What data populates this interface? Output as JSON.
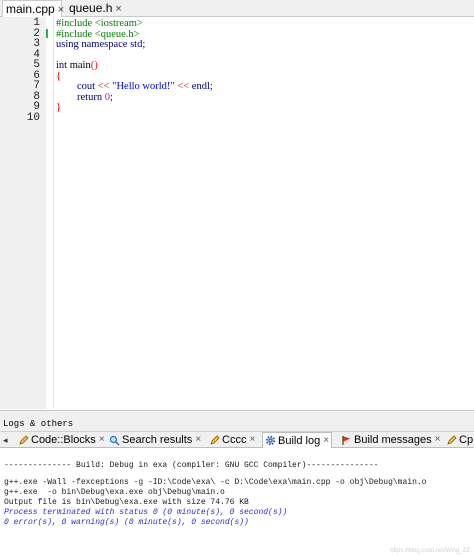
{
  "editor": {
    "tabs": [
      {
        "label": "main.cpp",
        "close": "×"
      },
      {
        "label": "queue.h",
        "close": "×"
      }
    ],
    "line_numbers": [
      "1",
      "2",
      "3",
      "4",
      "5",
      "6",
      "7",
      "8",
      "9",
      "10"
    ],
    "lines": {
      "l1": "#include <iostream>",
      "l2": "#include <queue.h>",
      "l3_kw": "using namespace",
      "l3_rest": " std;",
      "l5_kw": "int",
      "l5_name": " main",
      "l5_paren": "()",
      "l6": "{",
      "l7_a": "cout ",
      "l7_op1": "<<",
      "l7_str": " \"Hello world!\" ",
      "l7_op2": "<<",
      "l7_b": " endl;",
      "l8_kw": "return",
      "l8_num": " 0",
      "l8_end": ";",
      "l9": "}"
    }
  },
  "logs": {
    "title": "Logs & others",
    "scroll_arrow": "◂",
    "tabs": [
      {
        "label": "Code::Blocks",
        "close": "×"
      },
      {
        "label": "Search results",
        "close": "×"
      },
      {
        "label": "Cccc",
        "close": "×"
      },
      {
        "label": "Build log",
        "close": "×"
      },
      {
        "label": "Build messages",
        "close": "×"
      },
      {
        "label": "Cp"
      }
    ],
    "lines": [
      "-------------- Build: Debug in exa (compiler: GNU GCC Compiler)---------------",
      "g++.exe -Wall -fexceptions -g -ID:\\Code\\exa\\ -c D:\\Code\\exa\\main.cpp -o obj\\Debug\\main.o",
      "g++.exe  -o bin\\Debug\\exa.exe obj\\Debug\\main.o",
      "Output file is bin\\Debug\\exa.exe with size 74.76 KB",
      "Process terminated with status 0 (0 minute(s), 0 second(s))",
      "0 error(s), 0 warning(s) (0 minute(s), 0 second(s))"
    ],
    "watermark": "https://blog.csdn.net/Wing_ZZ"
  }
}
